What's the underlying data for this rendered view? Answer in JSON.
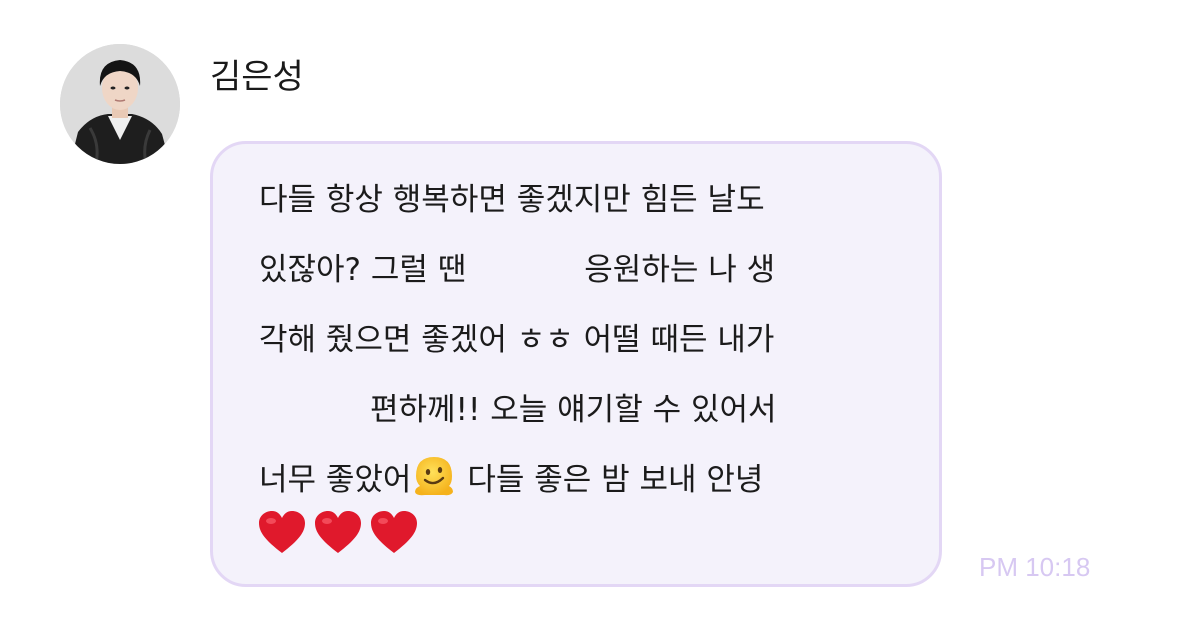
{
  "sender": {
    "name": "김은성"
  },
  "message": {
    "line1": "다들 항상 행복하면 좋겠지만 힘든 날도",
    "line2a": "있잖아? 그럴 땐",
    "line2b": "응원하는 나 생",
    "line3": "각해 줬으면 좋겠어 ㅎㅎ 어떨 때든 내가",
    "line4": "편하께!! 오늘 얘기할 수 있어서",
    "line5a": "너무 좋았어",
    "line5b": " 다들 좋은 밤 보내 안녕",
    "emojis": [
      "melting-face",
      "red-heart",
      "red-heart",
      "red-heart"
    ]
  },
  "timestamp": "PM 10:18",
  "colors": {
    "bubble_bg": "#f4f2fb",
    "bubble_border": "#e3d7f5",
    "timestamp": "#d7c8f2",
    "heart": "#e0192c"
  }
}
